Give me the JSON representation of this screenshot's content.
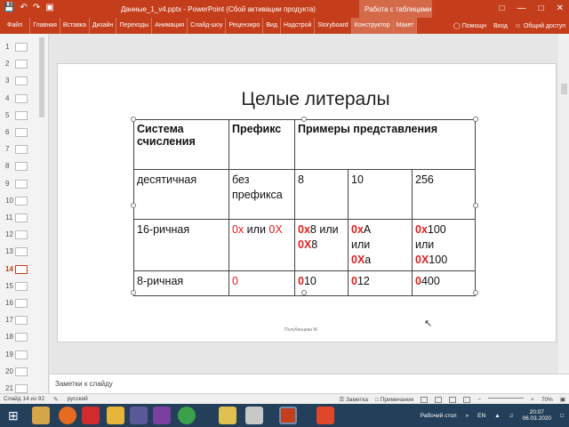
{
  "titlebar": {
    "title": "Данные_1_v4.pptx  -  PowerPoint (Сбой активации продукта)",
    "context_tab": "Работа с таблицами"
  },
  "ribbon": {
    "tabs": [
      "Файл",
      "Главная",
      "Вставка",
      "Дизайн",
      "Переходы",
      "Анимация",
      "Слайд-шоу",
      "Рецензиро",
      "Вид",
      "Надстрой",
      "Storyboard",
      "Конструктор",
      "Макет"
    ],
    "help": "Помощн",
    "signin": "Вход",
    "share": "Общий доступ"
  },
  "thumbnails": {
    "numbers": [
      "1",
      "2",
      "3",
      "4",
      "5",
      "6",
      "7",
      "8",
      "9",
      "10",
      "11",
      "12",
      "13",
      "14",
      "15",
      "16",
      "17",
      "18",
      "19",
      "20",
      "21"
    ],
    "active_index": 13
  },
  "slide": {
    "title": "Целые литералы",
    "author": "Полубенцева М.",
    "table": {
      "headers": [
        "Система счисления",
        "Префикс",
        "Примеры представления"
      ],
      "rows": [
        {
          "system": "десятичная",
          "prefix": "без префикса",
          "ex1": "8",
          "ex2": "10",
          "ex3": "256"
        },
        {
          "system": "16-ричная",
          "prefix_a": "0x",
          "prefix_sep": " или ",
          "prefix_b": "0X",
          "ex1_a_pre": "0x",
          "ex1_a_val": "8",
          "ex1_sep": " или ",
          "ex1_b_pre": "0X",
          "ex1_b_val": "8",
          "ex2_a_pre": "0x",
          "ex2_a_val": "A",
          "ex2_sep": "или",
          "ex2_b_pre": "0X",
          "ex2_b_val": "a",
          "ex3_a_pre": "0x",
          "ex3_a_val": "100",
          "ex3_sep": "или",
          "ex3_b_pre": "0X",
          "ex3_b_val": "100"
        },
        {
          "system": "8-ричная",
          "prefix": "0",
          "ex1_pre": "0",
          "ex1_val": "10",
          "ex2_pre": "0",
          "ex2_val": "12",
          "ex3_pre": "0",
          "ex3_val": "400"
        }
      ]
    }
  },
  "notes": {
    "placeholder": "Заметки к слайду"
  },
  "status": {
    "slide_count": "Слайд 14 из 92",
    "language": "русский",
    "notes_btn": "Заметка",
    "comments_btn": "Примечания",
    "zoom": "70%"
  },
  "taskbar": {
    "desktop": "Рабочий стол",
    "lang": "EN",
    "time": "20:07",
    "date": "06.03.2020"
  },
  "colors": {
    "brand": "#c43e1c",
    "prefix_red": "#e02020",
    "taskbar": "#243f5a"
  }
}
